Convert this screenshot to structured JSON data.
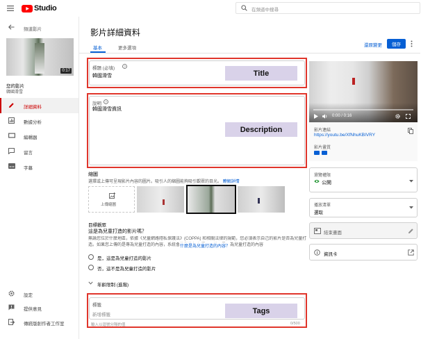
{
  "header": {
    "logo_text": "Studio",
    "search_placeholder": "在頻道中搜尋"
  },
  "sidebar": {
    "back_label": "頻道影片",
    "video_duration": "0:17",
    "video_title": "您的影片",
    "video_subtitle": "韓國滑雪",
    "items": [
      {
        "label": "詳細資料",
        "icon": "pencil-icon"
      },
      {
        "label": "數據分析",
        "icon": "analytics-icon"
      },
      {
        "label": "編輯器",
        "icon": "editor-icon"
      },
      {
        "label": "留言",
        "icon": "comments-icon"
      },
      {
        "label": "字幕",
        "icon": "subtitles-icon"
      }
    ],
    "bottom_items": [
      {
        "label": "設定",
        "icon": "gear-icon"
      },
      {
        "label": "提供意見",
        "icon": "feedback-icon"
      },
      {
        "label": "傳統版創作者工作室",
        "icon": "classic-studio-icon"
      }
    ]
  },
  "main": {
    "page_title": "影片詳細資料",
    "tabs": [
      "基本",
      "更多選項"
    ],
    "undo_label": "還原變更",
    "save_label": "儲存",
    "title_field": {
      "label": "標題 (必填)",
      "value": "韓國滑雪"
    },
    "description_field": {
      "label": "說明",
      "value": "韓國滑雪資訊"
    },
    "thumbnail": {
      "heading": "縮圖",
      "description": "選擇或上傳可呈現影片內容的圖片。吸引人的縮圖能夠吸引觀眾的目光。",
      "link": "瞭解詳情",
      "upload_label": "上傳縮圖"
    },
    "audience": {
      "heading": "目標觀眾",
      "question": "這是為兒童打造的影片嗎？",
      "description": "無論您位於什麼地區，依據《兒童網路隱私保護法》(COPPA) 和相關法律的規範，您必須表示自己的影片是否為兒童打造。如果您上傳的是專為兒童打造的內容，系統會為影片加上標示。說明是否為兒童打造的內容",
      "link": "什麼是為兒童打造的內容？",
      "yes_label": "是，這是為兒童打造的影片",
      "no_label": "否，這不是為兒童打造的影片"
    },
    "age_restriction_label": "年齡限制 (進階)",
    "tags_field": {
      "label": "標籤",
      "placeholder": "新增標籤",
      "hint": "輸入以逗號分隔的值",
      "counter": "0/500"
    }
  },
  "annotations": {
    "title": "Title",
    "description": "Description",
    "tags": "Tags"
  },
  "right_panel": {
    "time": "0:00 / 0:16",
    "video_link_label": "影片連結",
    "video_link": "https://youtu.be/XfNhuKBIVRY",
    "video_quality_label": "影片畫質",
    "visibility_label": "瀏覽權限",
    "visibility_value": "公開",
    "playlist_label": "播放清單",
    "playlist_value": "選取",
    "end_screen_label": "結束畫面",
    "cards_label": "資訊卡"
  },
  "colors": {
    "accent_blue": "#065fd4",
    "youtube_red": "#ff0000",
    "annotation_red": "#e0352b",
    "annotation_fill": "#d9d2e9"
  }
}
